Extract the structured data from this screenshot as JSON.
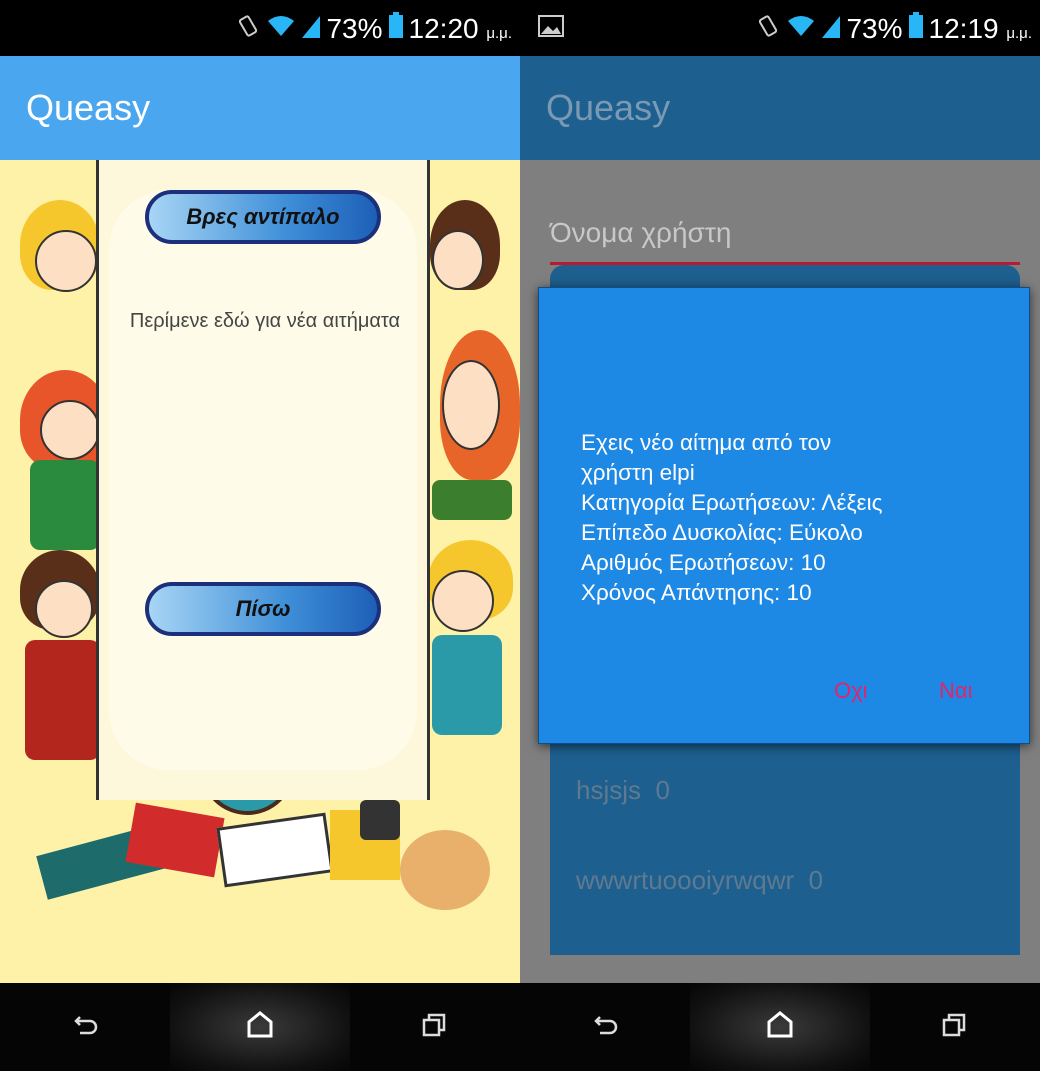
{
  "left": {
    "status": {
      "battery": "73%",
      "time": "12:20",
      "ampm": "μ.μ."
    },
    "app_title": "Queasy",
    "find_opponent_label": "Βρες αντίπαλο",
    "wait_text": "Περίμενε εδώ για νέα αιτήματα",
    "back_label": "Πίσω"
  },
  "right": {
    "status": {
      "battery": "73%",
      "time": "12:19",
      "ampm": "μ.μ."
    },
    "app_title": "Queasy",
    "username_placeholder": "Όνομα χρήστη",
    "rows": [
      {
        "name": "hsjsjs",
        "score": "0"
      },
      {
        "name": "wwwrtuoooiyrwqwr",
        "score": "0"
      }
    ],
    "dialog": {
      "message": "Εχεις νέο αίτημα από τον\nχρήστη elpi\nΚατηγορία Ερωτήσεων: Λέξεις\nΕπίπεδο Δυσκολίας: Εύκολο\nΑριθμός Ερωτήσεων: 10\n Χρόνος Απάντησης: 10",
      "no_label": "Οχι",
      "yes_label": "Ναι"
    }
  },
  "colors": {
    "appbar": "#4aa6ee",
    "appbar_dimmed": "#1d5f8e",
    "dialog_bg": "#1e88e5",
    "dialog_button": "#e0256a",
    "field_underline": "#b51b33"
  },
  "icons": [
    "vibrate-icon",
    "wifi-icon",
    "signal-icon",
    "battery-icon",
    "image-notification-icon",
    "back-icon",
    "home-icon",
    "recents-icon"
  ]
}
